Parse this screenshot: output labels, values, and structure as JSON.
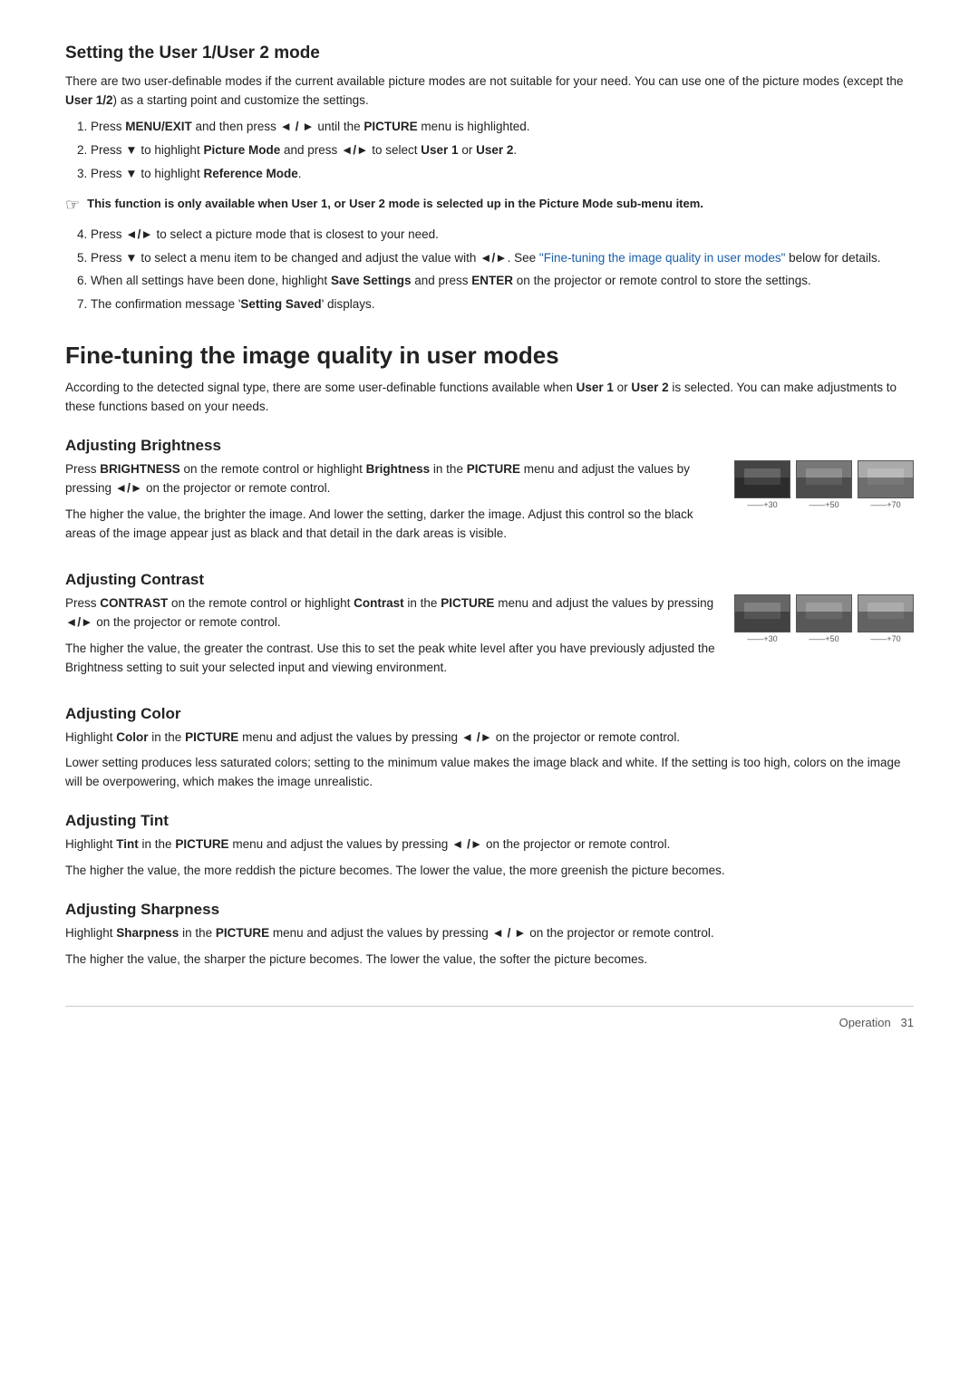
{
  "page": {
    "section1": {
      "heading": "Setting the User 1/User 2 mode",
      "intro": "There are two user-definable modes if the current available picture modes are not suitable for your need. You can use one of the picture modes (except the",
      "intro_bold1": "User 1/2",
      "intro2": ") as a starting point and customize the settings.",
      "steps": [
        {
          "id": 1,
          "pre": "Press ",
          "bold1": "MENU/EXIT",
          "mid": " and then press ",
          "arrow": "◄ / ►",
          "post": " until the ",
          "bold2": "PICTURE",
          "post2": " menu is highlighted."
        },
        {
          "id": 2,
          "pre": "Press ",
          "arrow1": "▼",
          "mid": " to highlight ",
          "bold1": "Picture Mode",
          "mid2": " and press ",
          "arrow2": "◄/►",
          "mid3": " to select ",
          "bold2": "User 1",
          "mid4": " or ",
          "bold3": "User 2",
          "post": "."
        },
        {
          "id": 3,
          "pre": "Press ",
          "arrow1": "▼",
          "mid": " to highlight ",
          "bold1": "Reference Mode",
          "post": "."
        }
      ],
      "note": "This function is only available when User 1, or User 2 mode is selected up in the Picture Mode sub-menu item.",
      "steps2": [
        {
          "id": 4,
          "text": "Press ◄/► to select a picture mode that is closest to your need."
        },
        {
          "id": 5,
          "pre": "Press ▼ to select a menu item to be changed and adjust the value with ◄/►. See ",
          "link": "\"Fine-tuning the image quality in user modes\"",
          "post": " below for details."
        },
        {
          "id": 6,
          "text": "When all settings have been done, highlight Save Settings and press ENTER on the projector or remote control to store the settings."
        },
        {
          "id": 7,
          "text": "The confirmation message 'Setting Saved' displays."
        }
      ]
    },
    "section2": {
      "heading": "Fine-tuning the image quality in user modes",
      "intro": "According to the detected signal type, there are some user-definable functions available when",
      "bold1": "User 1",
      "mid": " or ",
      "bold2": "User 2",
      "post": " is selected. You can make adjustments to these functions based on your needs.",
      "subsections": [
        {
          "id": "brightness",
          "heading": "Adjusting Brightness",
          "para1_pre": "Press ",
          "para1_bold1": "BRIGHTNESS",
          "para1_mid": " on the remote control or highlight ",
          "para1_bold2": "Brightness",
          "para1_post": " in the",
          "para1_bold3": "PICTURE",
          "para1_post2": " menu and adjust the values by pressing ",
          "para1_arrow": "◄/►",
          "para1_post3": " on the projector or remote control.",
          "para2": "The higher the value, the brighter the image. And lower the setting, darker the image. Adjust this control so the black areas of the image appear just as black and that detail in the dark areas is visible.",
          "images": [
            {
              "label": "+30",
              "style": "darker"
            },
            {
              "label": "+50",
              "style": "medium"
            },
            {
              "label": "+70",
              "style": "lighter"
            }
          ]
        },
        {
          "id": "contrast",
          "heading": "Adjusting Contrast",
          "para1_pre": "Press ",
          "para1_bold1": "CONTRAST",
          "para1_mid": " on the remote control or highlight ",
          "para1_bold2": "Contrast",
          "para1_post": " in the",
          "para1_bold3": "PICTURE",
          "para1_post2": " menu and adjust the values by pressing ",
          "para1_arrow": "◄/►",
          "para1_post3": " on the projector or remote control.",
          "para2": "The higher the value, the greater the contrast. Use this to set the peak white level after you have previously adjusted the Brightness setting to suit your selected input and viewing environment.",
          "images": [
            {
              "label": "+30",
              "style": "contrast-low"
            },
            {
              "label": "+50",
              "style": "contrast-mid"
            },
            {
              "label": "+70",
              "style": "contrast-high"
            }
          ]
        },
        {
          "id": "color",
          "heading": "Adjusting Color",
          "para1_pre": "Highlight ",
          "para1_bold1": "Color",
          "para1_mid": " in the ",
          "para1_bold2": "PICTURE",
          "para1_post": " menu and adjust the values by pressing ",
          "para1_arrow": "◄ /►",
          "para1_post2": " on the projector or remote control.",
          "para2": "Lower setting produces less saturated colors; setting to the minimum value makes the image black and white. If the setting is too high, colors on the image will be overpowering, which makes the image unrealistic."
        },
        {
          "id": "tint",
          "heading": "Adjusting Tint",
          "para1_pre": "Highlight ",
          "para1_bold1": "Tint",
          "para1_mid": " in the ",
          "para1_bold2": "PICTURE",
          "para1_post": " menu and adjust the values by pressing ",
          "para1_arrow": "◄ /►",
          "para1_post2": " on the projector or remote control.",
          "para2": "The higher the value, the more reddish the picture becomes. The lower the value, the more greenish the picture becomes."
        },
        {
          "id": "sharpness",
          "heading": "Adjusting Sharpness",
          "para1_pre": "Highlight ",
          "para1_bold1": "Sharpness",
          "para1_mid": " in the ",
          "para1_bold2": "PICTURE",
          "para1_post": " menu and adjust the values by pressing ",
          "para1_arrow": "◄ / ►",
          "para1_post2": " on the projector or remote control.",
          "para2": "The higher the value, the sharper the picture becomes. The lower the value, the softer the picture becomes."
        }
      ]
    },
    "footer": {
      "label": "Operation",
      "page": "31"
    }
  }
}
